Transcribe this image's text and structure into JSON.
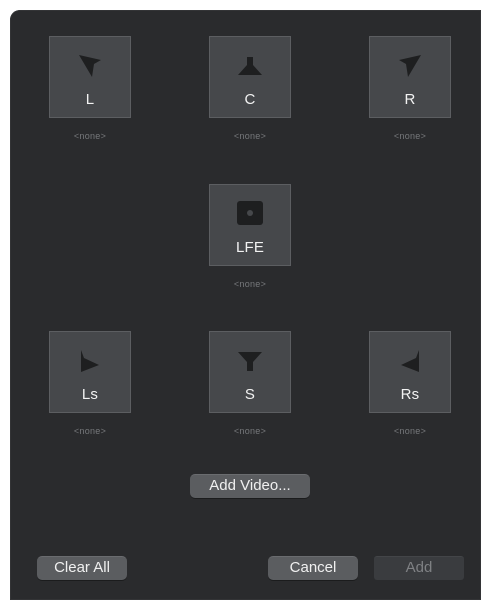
{
  "speakers": [
    {
      "id": "L",
      "label": "L",
      "assignment": "<none>",
      "icon": "speaker-front-left-icon"
    },
    {
      "id": "C",
      "label": "C",
      "assignment": "<none>",
      "icon": "speaker-center-icon"
    },
    {
      "id": "R",
      "label": "R",
      "assignment": "<none>",
      "icon": "speaker-front-right-icon"
    },
    {
      "id": "LFE",
      "label": "LFE",
      "assignment": "<none>",
      "icon": "subwoofer-icon"
    },
    {
      "id": "Ls",
      "label": "Ls",
      "assignment": "<none>",
      "icon": "speaker-surround-left-icon"
    },
    {
      "id": "S",
      "label": "S",
      "assignment": "<none>",
      "icon": "speaker-surround-icon"
    },
    {
      "id": "Rs",
      "label": "Rs",
      "assignment": "<none>",
      "icon": "speaker-surround-right-icon"
    }
  ],
  "buttons": {
    "add_video": "Add Video...",
    "clear_all": "Clear All",
    "cancel": "Cancel",
    "add": "Add"
  },
  "colors": {
    "background": "#2a2b2d",
    "tile": "#46484b",
    "button": "#5b5d60",
    "icon": "#1e1f20"
  }
}
